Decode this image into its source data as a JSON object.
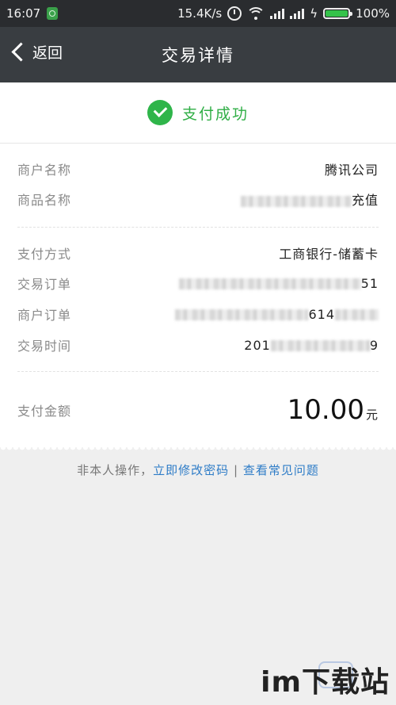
{
  "status_bar": {
    "time": "16:07",
    "net_speed": "15.4K/s",
    "battery": "100%",
    "battery_level": 1.0,
    "icons": [
      "shield-icon",
      "alarm-icon",
      "wifi-icon",
      "signal-icon",
      "signal-icon",
      "charging-icon",
      "battery-icon"
    ]
  },
  "nav": {
    "back_label": "返回",
    "title": "交易详情"
  },
  "result": {
    "text": "支付成功",
    "color": "#2fb54a"
  },
  "details_1": [
    {
      "label": "商户名称",
      "value": "腾讯公司"
    },
    {
      "label": "商品名称",
      "value": "充值"
    }
  ],
  "details_2": [
    {
      "label": "支付方式",
      "value": "工商银行-储蓄卡"
    },
    {
      "label": "交易订单",
      "value": "51"
    },
    {
      "label": "商户订单",
      "value": "614"
    },
    {
      "label": "交易时间",
      "value_prefix": "201",
      "value_suffix": "9"
    }
  ],
  "amount": {
    "label": "支付金额",
    "value": "10.00",
    "unit": "元"
  },
  "footer": {
    "prefix": "非本人操作，",
    "link1": "立即修改密码",
    "separator": "|",
    "link2": "查看常见问题"
  },
  "watermark": "im下载站",
  "colors": {
    "navbar": "#393d41",
    "success": "#2fae45",
    "link": "#2e7cc7"
  }
}
